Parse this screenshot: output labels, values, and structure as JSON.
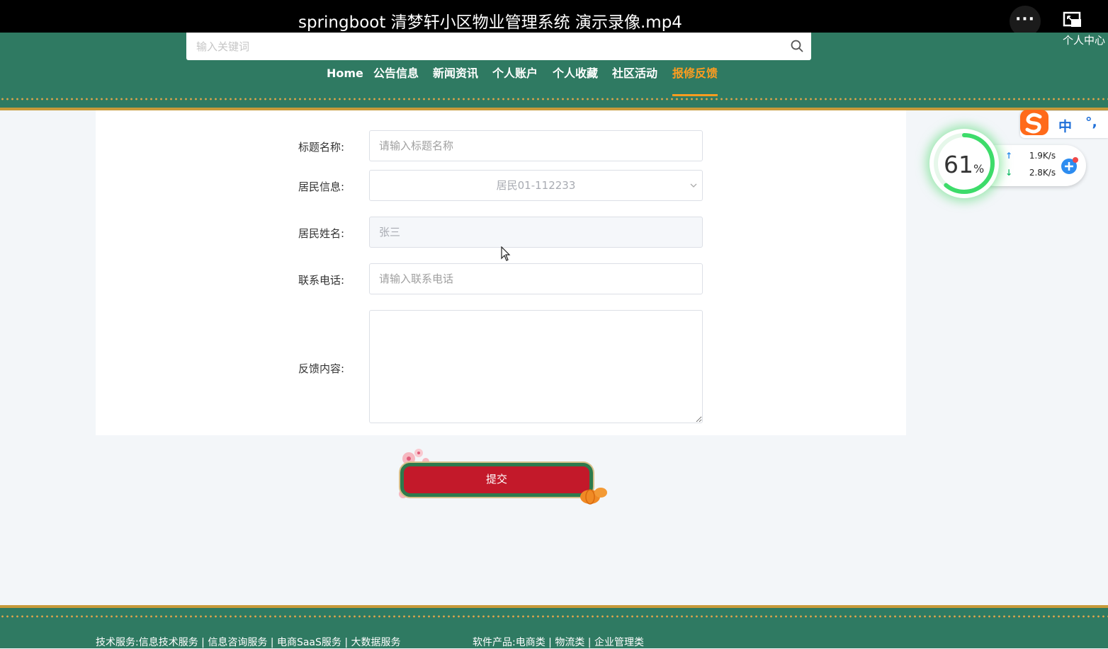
{
  "video": {
    "title": "springboot 清梦轩小区物业管理系统 演示录像.mp4",
    "more_label": "···"
  },
  "header": {
    "search_placeholder": "输入关键词",
    "user_center": "个人中心",
    "nav": [
      {
        "label": "Home",
        "active": false
      },
      {
        "label": "公告信息",
        "active": false
      },
      {
        "label": "新闻资讯",
        "active": false
      },
      {
        "label": "个人账户",
        "active": false
      },
      {
        "label": "个人收藏",
        "active": false
      },
      {
        "label": "社区活动",
        "active": false
      },
      {
        "label": "报修反馈",
        "active": true
      }
    ]
  },
  "form": {
    "title_label": "标题名称:",
    "title_placeholder": "请输入标题名称",
    "resident_info_label": "居民信息:",
    "resident_info_value": "居民01-112233",
    "resident_name_label": "居民姓名:",
    "resident_name_value": "张三",
    "phone_label": "联系电话:",
    "phone_placeholder": "请输入联系电话",
    "content_label": "反馈内容:",
    "content_value": "",
    "submit_label": "提交"
  },
  "footer": {
    "tech_services": "技术服务:信息技术服务 | 信息咨询服务 | 电商SaaS服务 | 大数据服务",
    "software_products": "软件产品:电商类 | 物流类 | 企业管理类"
  },
  "overlay": {
    "ime_mode": "中",
    "ime_punct": "°,",
    "cpu_percent": "61",
    "cpu_unit": "%",
    "upload_speed": "1.9K/s",
    "download_speed": "2.8K/s"
  },
  "colors": {
    "header_green": "#2f7a62",
    "active_orange": "#ff9d1f",
    "submit_red": "#c3192a",
    "gold": "#c79a3a"
  }
}
